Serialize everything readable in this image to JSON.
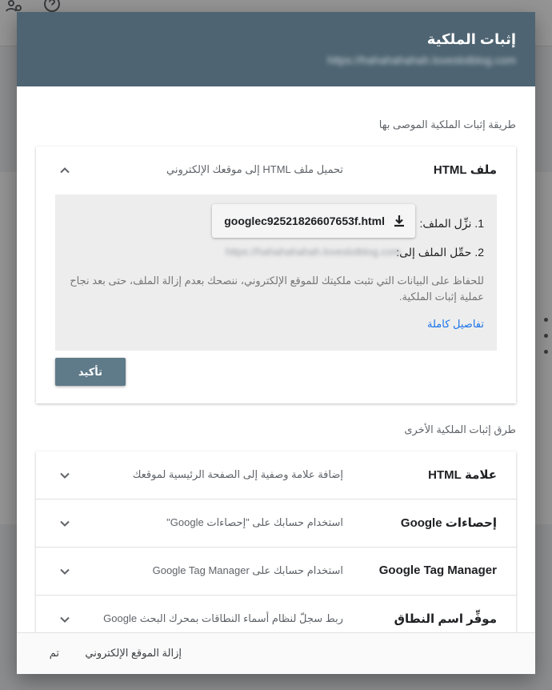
{
  "dialog": {
    "title": "إثبات الملكية",
    "subtitle": "https://hahahahahah.loveslotblog.com"
  },
  "recommended": {
    "section_label": "طريقة إثبات الملكية الموصى بها",
    "method": {
      "title": "ملف HTML",
      "description": "تحميل ملف HTML إلى موقعك الإلكتروني",
      "icon": "chevron-up-icon"
    },
    "step1_label": "1. نزِّل الملف:",
    "download_filename": "googlec92521826607653f.html",
    "download_icon": "download-icon",
    "step2_label": "2. حمِّل الملف إلى:",
    "step2_url": "https://hahahahahah.loveslotblog.com",
    "note": "للحفاظ على البيانات التي تثبت ملكيتك للموقع الإلكتروني، ننصحك بعدم إزالة الملف، حتى بعد نجاح عملية إثبات الملكية.",
    "details_link": "تفاصيل كاملة",
    "confirm_button": "تأكيد"
  },
  "other": {
    "section_label": "طرق إثبات الملكية الأخرى",
    "methods": [
      {
        "title": "علامة HTML",
        "description": "إضافة علامة وصفية إلى الصفحة الرئيسية لموقعك",
        "icon": "chevron-down-icon"
      },
      {
        "title": "إحصاءات Google",
        "description": "استخدام حسابك على \"إحصاءات Google\"",
        "icon": "chevron-down-icon"
      },
      {
        "title": "Google Tag Manager",
        "description": "استخدام حسابك على Google Tag Manager",
        "icon": "chevron-down-icon"
      },
      {
        "title": "موفِّر اسم النطاق",
        "description": "ربط سجلّ لنظام أسماء النطاقات بمحرك البحث Google",
        "icon": "chevron-down-icon"
      }
    ]
  },
  "footer": {
    "remove_site": "إزالة الموقع الإلكتروني",
    "done": "تم"
  },
  "colors": {
    "header_bg": "#4e6472",
    "confirm_bg": "#5f7a89",
    "link": "#1a73e8"
  }
}
